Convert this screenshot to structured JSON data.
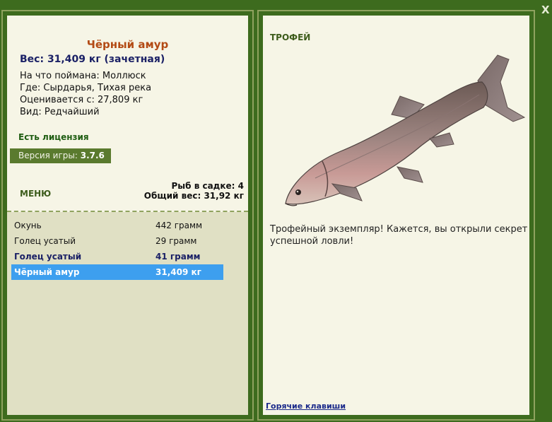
{
  "close_label": "X",
  "fish": {
    "name": "Чёрный амур",
    "weight_line": "Вес: 31,409 кг (зачетная)",
    "caught_on": "На что поймана: Моллюск",
    "where": "Где: Сырдарья, Тихая река",
    "valued_from": "Оценивается с: 27,809 кг",
    "kind": "Вид: Редчайший"
  },
  "license": "Есть лицензия",
  "version": {
    "label": "Версия игры:",
    "value": "3.7.6"
  },
  "menu_label": "МЕНЮ",
  "stats": {
    "fish_in_keepnet": "Рыб в садке: 4",
    "total_weight": "Общий вес: 31,92 кг"
  },
  "catch_list": [
    {
      "name": "Окунь",
      "weight": "442 грамм",
      "style": "normal"
    },
    {
      "name": "Голец усатый",
      "weight": "29 грамм",
      "style": "normal"
    },
    {
      "name": "Голец усатый",
      "weight": "41 грамм",
      "style": "bold"
    },
    {
      "name": "Чёрный амур",
      "weight": "31,409 кг",
      "style": "selected"
    }
  ],
  "trophy": {
    "label": "ТРОФЕЙ",
    "text": "Трофейный экземпляр! Кажется, вы открыли секрет успешной ловли!"
  },
  "hotkeys_link": "Горячие клавиши",
  "colors": {
    "background": "#3d6b1e",
    "panel": "#f6f5e6",
    "fish_name": "#b34a14",
    "selected_row": "#3d9fef",
    "link": "#1b2a8a"
  }
}
